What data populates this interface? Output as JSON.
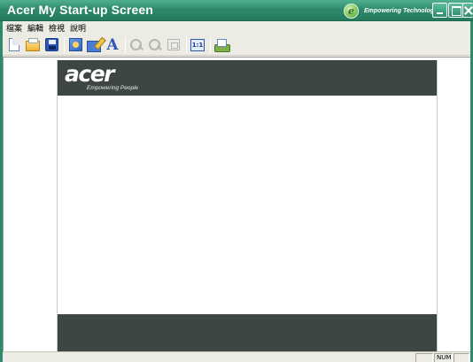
{
  "window": {
    "title": "Acer My Start-up Screen",
    "brand_mark": "e",
    "brand_text": "Empowering Technology"
  },
  "menu": {
    "items": [
      "檔案",
      "編輯",
      "檢視",
      "說明"
    ]
  },
  "toolbar": {
    "buttons": [
      {
        "icon": "new-document-icon"
      },
      {
        "icon": "open-folder-icon"
      },
      {
        "icon": "save-icon"
      },
      {
        "icon": "import-image-icon"
      },
      {
        "icon": "edit-image-icon"
      },
      {
        "icon": "text-icon",
        "glyph": "A"
      },
      {
        "icon": "zoom-in-icon"
      },
      {
        "icon": "zoom-out-icon"
      },
      {
        "icon": "fit-window-icon"
      },
      {
        "icon": "actual-size-icon",
        "glyph": "1:1"
      },
      {
        "icon": "preview-icon"
      }
    ]
  },
  "preview": {
    "logo": "acer",
    "tagline": "Empowering People",
    "colors": {
      "banner": "#3d4645",
      "canvas": "#ffffff"
    }
  },
  "statusbar": {
    "panels": [
      "",
      "NUM",
      ""
    ]
  },
  "colors": {
    "titlebar": "#2e8a6c",
    "chrome": "#ecebe4"
  }
}
